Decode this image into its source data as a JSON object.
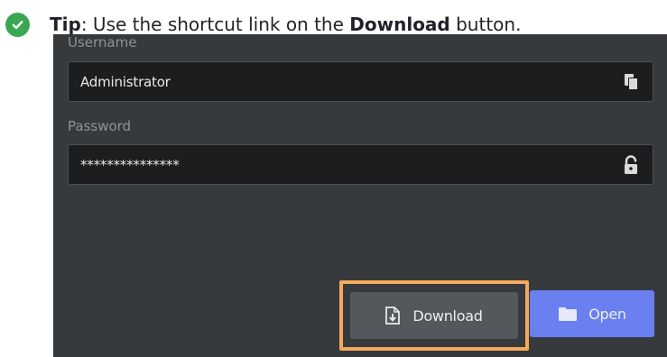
{
  "tip": {
    "prefix_bold": "Tip",
    "text_before": ": Use the shortcut link on the ",
    "emphasis": "Download",
    "text_after": " button.",
    "icon": "check-circle-icon",
    "icon_color": "#3aa852"
  },
  "form": {
    "username": {
      "label": "Username",
      "value": "Administrator",
      "action_icon": "copy-icon"
    },
    "password": {
      "label": "Password",
      "value": "***************",
      "action_icon": "unlock-icon"
    }
  },
  "buttons": {
    "download": {
      "label": "Download",
      "icon": "download-file-icon",
      "highlight_color": "#f4a95b"
    },
    "open": {
      "label": "Open",
      "icon": "folder-icon",
      "color": "#6a7ff0"
    }
  },
  "colors": {
    "panel_background": "#373a3d",
    "field_background": "#1c1d1f"
  }
}
